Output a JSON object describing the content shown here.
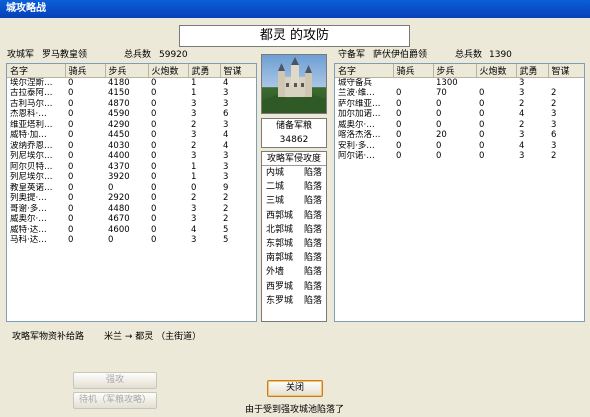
{
  "window": {
    "title": "城攻略战"
  },
  "battle_title": "都灵 的攻防",
  "attacker": {
    "side_label": "攻城军",
    "commander": "罗马教皇领",
    "total_label": "总兵数",
    "total": "59920",
    "columns": [
      "名字",
      "骑兵",
      "步兵",
      "火炮数",
      "武勇",
      "智谋"
    ],
    "rows": [
      [
        "埃尔涅斯…",
        "0",
        "4180",
        "0",
        "1",
        "4"
      ],
      [
        "古拉泰阿…",
        "0",
        "4150",
        "0",
        "1",
        "3"
      ],
      [
        "古利马尔…",
        "0",
        "4870",
        "0",
        "3",
        "3"
      ],
      [
        "杰恩科·…",
        "0",
        "4590",
        "0",
        "3",
        "6"
      ],
      [
        "维亚塔利…",
        "0",
        "4290",
        "0",
        "2",
        "3"
      ],
      [
        "威特·加…",
        "0",
        "4450",
        "0",
        "3",
        "4"
      ],
      [
        "波纳乔恩…",
        "0",
        "4030",
        "0",
        "2",
        "4"
      ],
      [
        "列尼埃尔…",
        "0",
        "4400",
        "0",
        "3",
        "3"
      ],
      [
        "阿尔贝特…",
        "0",
        "4370",
        "0",
        "1",
        "3"
      ],
      [
        "列尼埃尔…",
        "0",
        "3920",
        "0",
        "1",
        "3"
      ],
      [
        "教皇英诺…",
        "0",
        "0",
        "0",
        "0",
        "9"
      ],
      [
        "列奥提·…",
        "0",
        "2920",
        "0",
        "2",
        "2"
      ],
      [
        "哥谢·多…",
        "0",
        "4480",
        "0",
        "3",
        "2"
      ],
      [
        "威奥尔·…",
        "0",
        "4670",
        "0",
        "3",
        "2"
      ],
      [
        "威特·达…",
        "0",
        "4600",
        "0",
        "4",
        "5"
      ],
      [
        "马科·达…",
        "0",
        "0",
        "0",
        "3",
        "5"
      ]
    ]
  },
  "defender": {
    "side_label": "守备军",
    "commander": "萨伏伊伯爵领",
    "total_label": "总兵数",
    "total": "1390",
    "columns": [
      "名字",
      "骑兵",
      "步兵",
      "火炮数",
      "武勇",
      "智谋"
    ],
    "rows": [
      [
        "城守备兵",
        "",
        "1300",
        "",
        "3",
        ""
      ],
      [
        "兰波·维…",
        "0",
        "70",
        "0",
        "3",
        "2"
      ],
      [
        "萨尔维亚…",
        "0",
        "0",
        "0",
        "2",
        "2"
      ],
      [
        "加尔加诺…",
        "0",
        "0",
        "0",
        "4",
        "3"
      ],
      [
        "威奥尔·…",
        "0",
        "0",
        "0",
        "2",
        "3"
      ],
      [
        "喀洛杰洛…",
        "0",
        "20",
        "0",
        "3",
        "6"
      ],
      [
        "安利·多…",
        "0",
        "0",
        "0",
        "4",
        "3"
      ],
      [
        "阿尔诺·…",
        "0",
        "0",
        "0",
        "3",
        "2"
      ]
    ]
  },
  "reserve": {
    "label": "储备军粮",
    "value": "34862"
  },
  "siege": {
    "header": "攻略军侵攻度",
    "rows": [
      {
        "name": "内城",
        "status": "陷落"
      },
      {
        "name": "二城",
        "status": "陷落"
      },
      {
        "name": "三城",
        "status": "陷落"
      },
      {
        "name": "西郭城",
        "status": "陷落"
      },
      {
        "name": "北郭城",
        "status": "陷落"
      },
      {
        "name": "东郭城",
        "status": "陷落"
      },
      {
        "name": "南郭城",
        "status": "陷落"
      },
      {
        "name": "外墙",
        "status": "陷落"
      },
      {
        "name": "西罗城",
        "status": "陷落"
      },
      {
        "name": "东罗城",
        "status": "陷落"
      }
    ]
  },
  "supply": {
    "label": "攻略军物资补给路",
    "route": "米兰 → 都灵 （主街道）"
  },
  "buttons": {
    "assault": "强攻",
    "standby": "待机（军粮攻略）",
    "close": "关闭"
  },
  "status_text": "由于受到强攻城池陷落了"
}
